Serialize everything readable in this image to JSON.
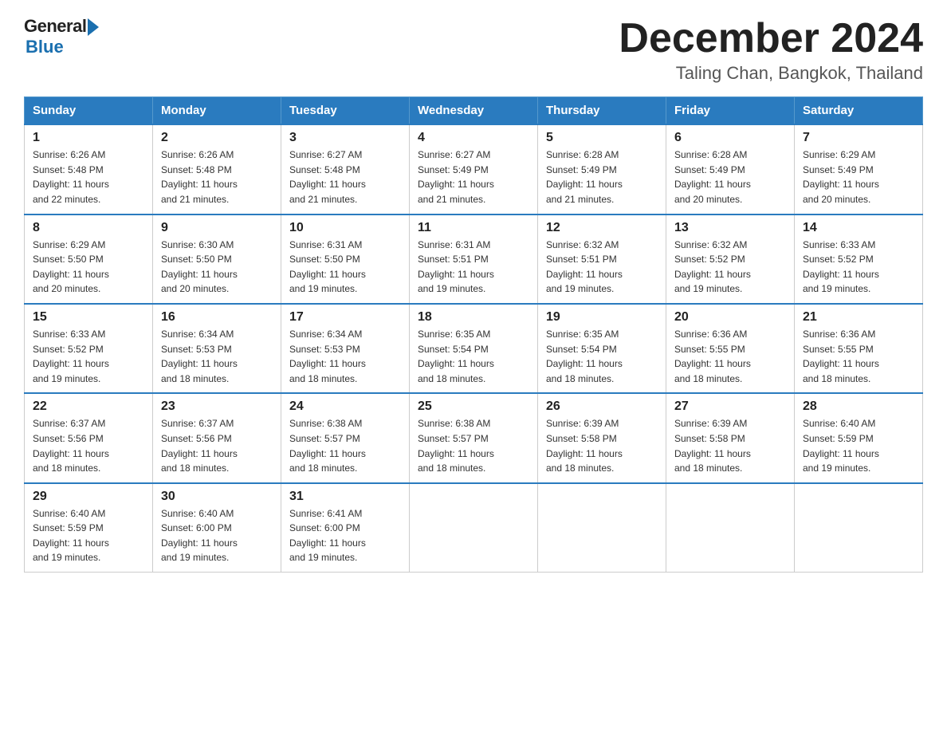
{
  "header": {
    "logo_general": "General",
    "logo_blue": "Blue",
    "title": "December 2024",
    "location": "Taling Chan, Bangkok, Thailand"
  },
  "calendar": {
    "days_of_week": [
      "Sunday",
      "Monday",
      "Tuesday",
      "Wednesday",
      "Thursday",
      "Friday",
      "Saturday"
    ],
    "weeks": [
      [
        {
          "day": "1",
          "sunrise": "6:26 AM",
          "sunset": "5:48 PM",
          "daylight": "11 hours and 22 minutes."
        },
        {
          "day": "2",
          "sunrise": "6:26 AM",
          "sunset": "5:48 PM",
          "daylight": "11 hours and 21 minutes."
        },
        {
          "day": "3",
          "sunrise": "6:27 AM",
          "sunset": "5:48 PM",
          "daylight": "11 hours and 21 minutes."
        },
        {
          "day": "4",
          "sunrise": "6:27 AM",
          "sunset": "5:49 PM",
          "daylight": "11 hours and 21 minutes."
        },
        {
          "day": "5",
          "sunrise": "6:28 AM",
          "sunset": "5:49 PM",
          "daylight": "11 hours and 21 minutes."
        },
        {
          "day": "6",
          "sunrise": "6:28 AM",
          "sunset": "5:49 PM",
          "daylight": "11 hours and 20 minutes."
        },
        {
          "day": "7",
          "sunrise": "6:29 AM",
          "sunset": "5:49 PM",
          "daylight": "11 hours and 20 minutes."
        }
      ],
      [
        {
          "day": "8",
          "sunrise": "6:29 AM",
          "sunset": "5:50 PM",
          "daylight": "11 hours and 20 minutes."
        },
        {
          "day": "9",
          "sunrise": "6:30 AM",
          "sunset": "5:50 PM",
          "daylight": "11 hours and 20 minutes."
        },
        {
          "day": "10",
          "sunrise": "6:31 AM",
          "sunset": "5:50 PM",
          "daylight": "11 hours and 19 minutes."
        },
        {
          "day": "11",
          "sunrise": "6:31 AM",
          "sunset": "5:51 PM",
          "daylight": "11 hours and 19 minutes."
        },
        {
          "day": "12",
          "sunrise": "6:32 AM",
          "sunset": "5:51 PM",
          "daylight": "11 hours and 19 minutes."
        },
        {
          "day": "13",
          "sunrise": "6:32 AM",
          "sunset": "5:52 PM",
          "daylight": "11 hours and 19 minutes."
        },
        {
          "day": "14",
          "sunrise": "6:33 AM",
          "sunset": "5:52 PM",
          "daylight": "11 hours and 19 minutes."
        }
      ],
      [
        {
          "day": "15",
          "sunrise": "6:33 AM",
          "sunset": "5:52 PM",
          "daylight": "11 hours and 19 minutes."
        },
        {
          "day": "16",
          "sunrise": "6:34 AM",
          "sunset": "5:53 PM",
          "daylight": "11 hours and 18 minutes."
        },
        {
          "day": "17",
          "sunrise": "6:34 AM",
          "sunset": "5:53 PM",
          "daylight": "11 hours and 18 minutes."
        },
        {
          "day": "18",
          "sunrise": "6:35 AM",
          "sunset": "5:54 PM",
          "daylight": "11 hours and 18 minutes."
        },
        {
          "day": "19",
          "sunrise": "6:35 AM",
          "sunset": "5:54 PM",
          "daylight": "11 hours and 18 minutes."
        },
        {
          "day": "20",
          "sunrise": "6:36 AM",
          "sunset": "5:55 PM",
          "daylight": "11 hours and 18 minutes."
        },
        {
          "day": "21",
          "sunrise": "6:36 AM",
          "sunset": "5:55 PM",
          "daylight": "11 hours and 18 minutes."
        }
      ],
      [
        {
          "day": "22",
          "sunrise": "6:37 AM",
          "sunset": "5:56 PM",
          "daylight": "11 hours and 18 minutes."
        },
        {
          "day": "23",
          "sunrise": "6:37 AM",
          "sunset": "5:56 PM",
          "daylight": "11 hours and 18 minutes."
        },
        {
          "day": "24",
          "sunrise": "6:38 AM",
          "sunset": "5:57 PM",
          "daylight": "11 hours and 18 minutes."
        },
        {
          "day": "25",
          "sunrise": "6:38 AM",
          "sunset": "5:57 PM",
          "daylight": "11 hours and 18 minutes."
        },
        {
          "day": "26",
          "sunrise": "6:39 AM",
          "sunset": "5:58 PM",
          "daylight": "11 hours and 18 minutes."
        },
        {
          "day": "27",
          "sunrise": "6:39 AM",
          "sunset": "5:58 PM",
          "daylight": "11 hours and 18 minutes."
        },
        {
          "day": "28",
          "sunrise": "6:40 AM",
          "sunset": "5:59 PM",
          "daylight": "11 hours and 19 minutes."
        }
      ],
      [
        {
          "day": "29",
          "sunrise": "6:40 AM",
          "sunset": "5:59 PM",
          "daylight": "11 hours and 19 minutes."
        },
        {
          "day": "30",
          "sunrise": "6:40 AM",
          "sunset": "6:00 PM",
          "daylight": "11 hours and 19 minutes."
        },
        {
          "day": "31",
          "sunrise": "6:41 AM",
          "sunset": "6:00 PM",
          "daylight": "11 hours and 19 minutes."
        },
        null,
        null,
        null,
        null
      ]
    ],
    "labels": {
      "sunrise": "Sunrise:",
      "sunset": "Sunset:",
      "daylight": "Daylight:"
    }
  }
}
